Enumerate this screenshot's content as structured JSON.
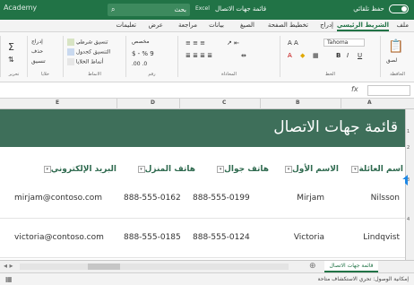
{
  "titlebar": {
    "autosave_label": "حفظ تلقائي",
    "title": "قائمة جهات الاتصال",
    "file_label": "Excel",
    "search_placeholder": "بحث",
    "left_label": "Academy"
  },
  "ribbon_tabs": [
    "ملف",
    "الشريط الرئيسي",
    "إدراج",
    "تخطيط الصفحة",
    "الصيغ",
    "بيانات",
    "مراجعة",
    "عرض",
    "تعليمات"
  ],
  "ribbon": {
    "clipboard_label": "الحافظة",
    "paste_label": "لصق",
    "font_name": "Tahoma",
    "font_label": "الخط",
    "alignment_label": "المحاذاة",
    "number_format": "مخصص",
    "number_label": "رقم",
    "styles": [
      "تنسيق شرطي",
      "التنسيق كجدول",
      "أنماط الخلايا"
    ],
    "styles_label": "الأنماط",
    "cells_items": [
      "إدراج",
      "حذف",
      "تنسيق"
    ],
    "cells_label": "خلايا",
    "editing_label": "تحرير"
  },
  "columns": [
    "A",
    "B",
    "C",
    "D",
    "E"
  ],
  "rows": [
    "1",
    "2",
    "3",
    "4"
  ],
  "banner": {
    "title": "قائمة جهات الاتصال"
  },
  "table": {
    "headers": [
      "اسم العائلة",
      "الاسم الأول",
      "هاتف جوال",
      "هاتف المنزل",
      "البريد الإلكتروني"
    ],
    "rows": [
      [
        "Nilsson",
        "Mirjam",
        "888-555-0199",
        "888-555-0162",
        "mirjam@contoso.com"
      ],
      [
        "Lindqvist",
        "Victoria",
        "888-555-0124",
        "888-555-0185",
        "victoria@contoso.com"
      ]
    ]
  },
  "sheet": {
    "tab_label": "قائمة جهات الاتصال"
  },
  "status": {
    "text": "إمكانية الوصول: تحري الاستكشاف متاحة"
  },
  "colors": {
    "accent": "#217346",
    "banner": "#3e6f5a",
    "header_text": "#2f6a4f",
    "selection": "#1e88e5"
  }
}
